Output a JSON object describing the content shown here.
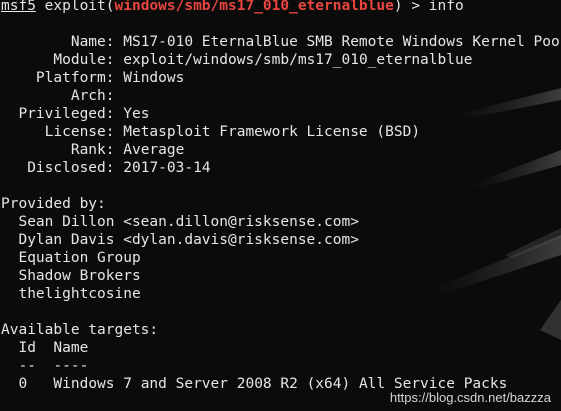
{
  "prompt": {
    "app": "msf5",
    "context_open": " exploit(",
    "module": "windows/smb/ms17_010_eternalblue",
    "context_close": ") > ",
    "command": "info"
  },
  "fields": [
    {
      "label": "Name",
      "value": "MS17-010 EternalBlue SMB Remote Windows Kernel Poo"
    },
    {
      "label": "Module",
      "value": "exploit/windows/smb/ms17_010_eternalblue"
    },
    {
      "label": "Platform",
      "value": "Windows"
    },
    {
      "label": "Arch",
      "value": ""
    },
    {
      "label": "Privileged",
      "value": "Yes"
    },
    {
      "label": "License",
      "value": "Metasploit Framework License (BSD)"
    },
    {
      "label": "Rank",
      "value": "Average"
    },
    {
      "label": "Disclosed",
      "value": "2017-03-14"
    }
  ],
  "provided_by": {
    "heading": "Provided by:",
    "authors": [
      "Sean Dillon <sean.dillon@risksense.com>",
      "Dylan Davis <dylan.davis@risksense.com>",
      "Equation Group",
      "Shadow Brokers",
      "thelightcosine"
    ]
  },
  "targets": {
    "heading": "Available targets:",
    "col_id": "Id",
    "col_name": "Name",
    "underline_id": "--",
    "underline_name": "----",
    "rows": [
      {
        "id": "0",
        "name": "Windows 7 and Server 2008 R2 (x64) All Service Packs"
      }
    ]
  },
  "watermark": "https://blog.csdn.net/bazzza",
  "colors": {
    "background": "#0b0b0b",
    "text": "#e6e6e6",
    "module_red": "#e8463e"
  }
}
